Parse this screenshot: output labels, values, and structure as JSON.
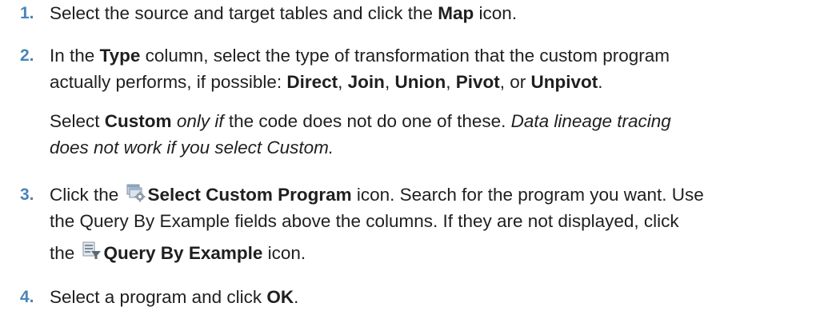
{
  "steps": [
    {
      "number": "1.",
      "lines": [
        [
          {
            "t": "Select the source and target tables and click the "
          },
          {
            "t": "Map",
            "b": true
          },
          {
            "t": " icon."
          }
        ]
      ]
    },
    {
      "number": "2.",
      "lines": [
        [
          {
            "t": "In the "
          },
          {
            "t": "Type",
            "b": true
          },
          {
            "t": " column, select the type of transformation that the custom program"
          }
        ],
        [
          {
            "t": "actually performs, if possible: "
          },
          {
            "t": "Direct",
            "b": true
          },
          {
            "t": ", "
          },
          {
            "t": "Join",
            "b": true
          },
          {
            "t": ", "
          },
          {
            "t": "Union",
            "b": true
          },
          {
            "t": ", "
          },
          {
            "t": "Pivot",
            "b": true
          },
          {
            "t": ", or "
          },
          {
            "t": "Unpivot",
            "b": true
          },
          {
            "t": "."
          }
        ]
      ],
      "note_lines": [
        [
          {
            "t": "Select "
          },
          {
            "t": "Custom",
            "b": true
          },
          {
            "t": " "
          },
          {
            "t": "only if",
            "i": true
          },
          {
            "t": " the code does not do one of these. "
          },
          {
            "t": "Data lineage tracing",
            "i": true
          }
        ],
        [
          {
            "t": "does not work if you select Custom.",
            "i": true
          }
        ]
      ]
    },
    {
      "number": "3.",
      "lines": [
        [
          {
            "t": "Click the "
          },
          {
            "icon": "select-custom-program-icon"
          },
          {
            "t": "Select Custom Program",
            "b": true
          },
          {
            "t": " icon. Search for the program you want. Use"
          }
        ],
        [
          {
            "t": "the Query By Example fields above the columns. If they are not displayed, click"
          }
        ],
        [
          {
            "t": "the "
          },
          {
            "icon": "query-by-example-icon"
          },
          {
            "t": "Query By Example",
            "b": true
          },
          {
            "t": " icon."
          }
        ]
      ]
    },
    {
      "number": "4.",
      "lines": [
        [
          {
            "t": "Select a program and click "
          },
          {
            "t": "OK",
            "b": true
          },
          {
            "t": "."
          }
        ]
      ]
    }
  ],
  "colors": {
    "number": "#4a84b8",
    "text": "#1f1f1f"
  }
}
